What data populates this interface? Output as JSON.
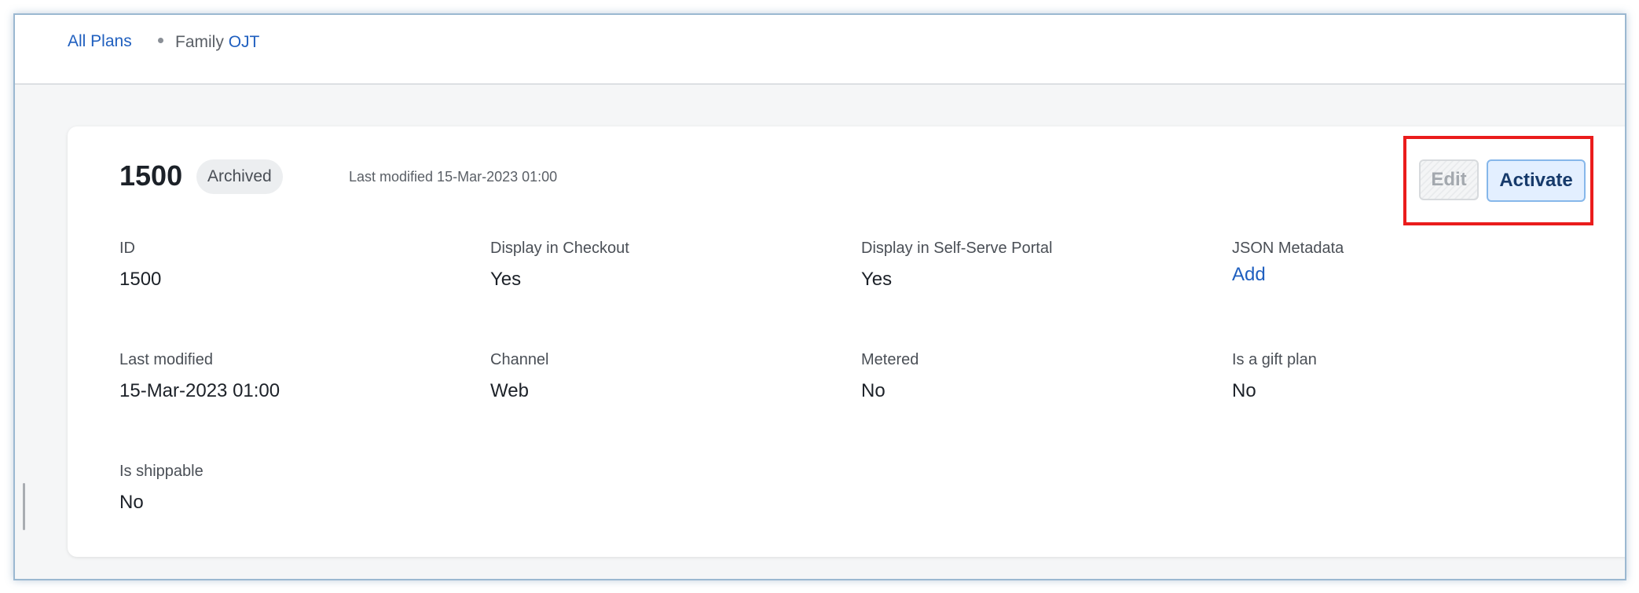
{
  "breadcrumb": {
    "root_label": "All Plans",
    "family_prefix": "Family",
    "family_code": "OJT"
  },
  "plan": {
    "title": "1500",
    "status": "Archived",
    "last_modified_note": "Last modified 15-Mar-2023 01:00"
  },
  "actions": {
    "edit_label": "Edit",
    "activate_label": "Activate",
    "highlight_color": "#ea1c1c"
  },
  "fields": {
    "id": {
      "label": "ID",
      "value": "1500"
    },
    "display_checkout": {
      "label": "Display in Checkout",
      "value": "Yes"
    },
    "display_portal": {
      "label": "Display in Self-Serve Portal",
      "value": "Yes"
    },
    "json_metadata": {
      "label": "JSON Metadata",
      "value": "Add"
    },
    "last_modified": {
      "label": "Last modified",
      "value": "15-Mar-2023 01:00"
    },
    "channel": {
      "label": "Channel",
      "value": "Web"
    },
    "metered": {
      "label": "Metered",
      "value": "No"
    },
    "gift_plan": {
      "label": "Is a gift plan",
      "value": "No"
    },
    "shippable": {
      "label": "Is shippable",
      "value": "No"
    }
  },
  "colors": {
    "link": "#1f5fbf",
    "activate_bg": "#e3efff",
    "activate_border": "#86b7ea",
    "page_bg": "#f5f6f7"
  }
}
